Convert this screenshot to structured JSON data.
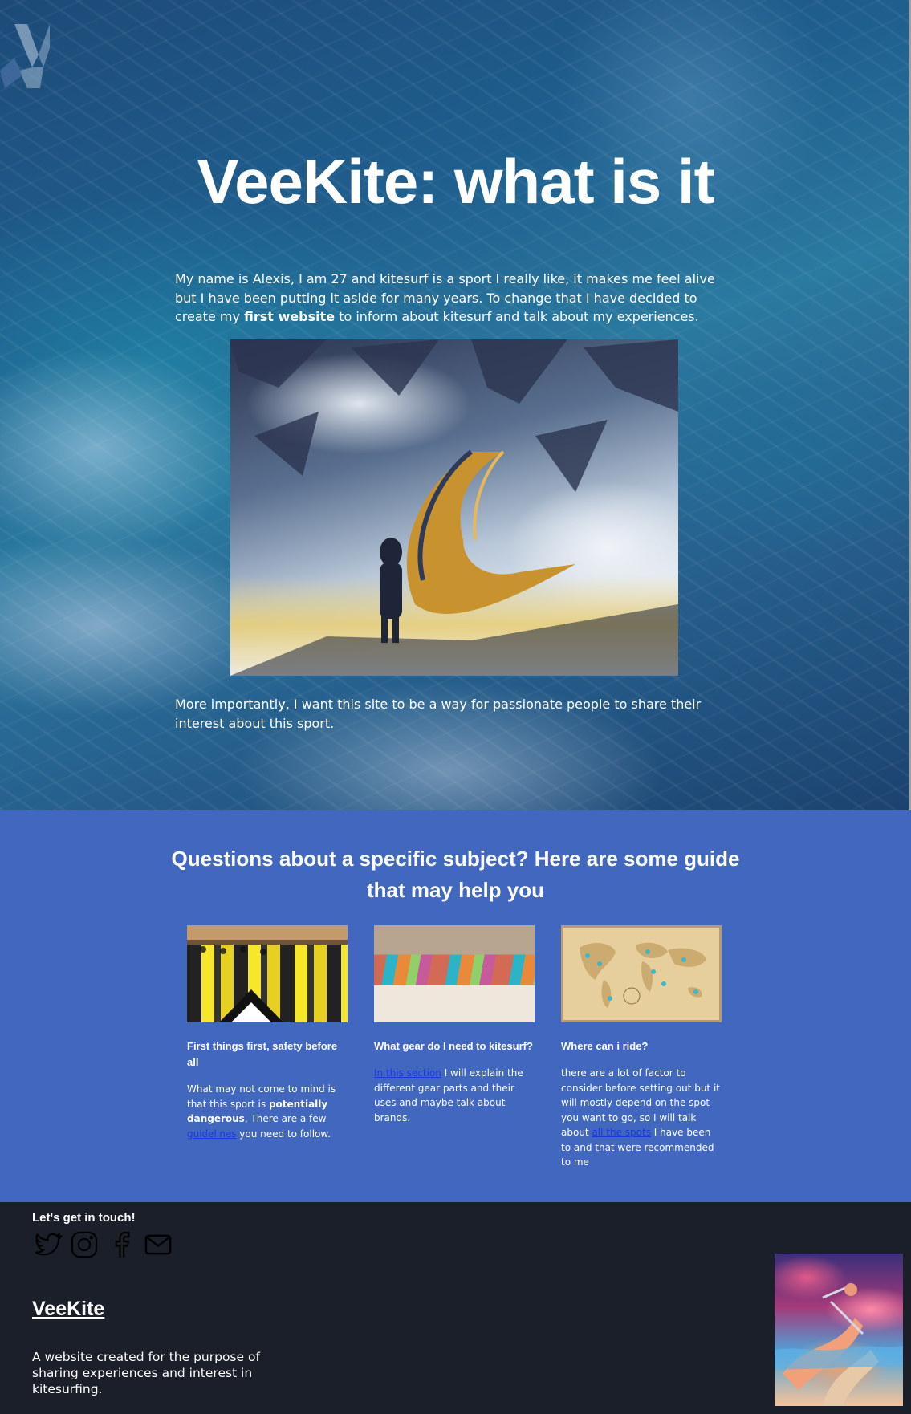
{
  "hero": {
    "title": "VeeKite: what is it",
    "intro_before": "My name is Alexis, I am 27 and kitesurf is a sport I really like, it makes me feel alive but I have been putting it aside for many years. To change that I have decided to create my ",
    "intro_bold": "first website",
    "intro_after": " to inform about kitesurf and talk about my experiences.",
    "outro": "More importantly, I want this site to be a way for passionate people to share their interest about this sport."
  },
  "guides": {
    "title": "Questions about a specific subject? Here are some guide that may help you",
    "cards": [
      {
        "title": "First things first, safety before all",
        "text_1": "What may not come to mind is that this sport is ",
        "bold": "potentially dangerous",
        "text_2": ", There are a few ",
        "link": "guidelines",
        "text_3": " you need to follow."
      },
      {
        "title": "What gear do I need to kitesurf?",
        "link": "In this section",
        "text_1": " I will explain the different gear parts and their uses and maybe talk about brands."
      },
      {
        "title": "Where can i ride?",
        "text_1": "there are a lot of factor to consider before setting out but it will mostly depend on the spot you want to go, so I will talk about ",
        "link": "all the spots",
        "text_2": " I have been to and that were recommended to me"
      }
    ]
  },
  "footer": {
    "contact_title": "Let's get in touch!",
    "socials": [
      "twitter-icon",
      "instagram-icon",
      "facebook-icon",
      "mail-icon"
    ],
    "brand": "VeeKite",
    "tagline": "A website created for the purpose of sharing experiences and interest in kitesurfing."
  },
  "colors": {
    "guides_bg": "#4168be",
    "footer_bg": "#1b1f29",
    "link": "#1a37e0"
  }
}
